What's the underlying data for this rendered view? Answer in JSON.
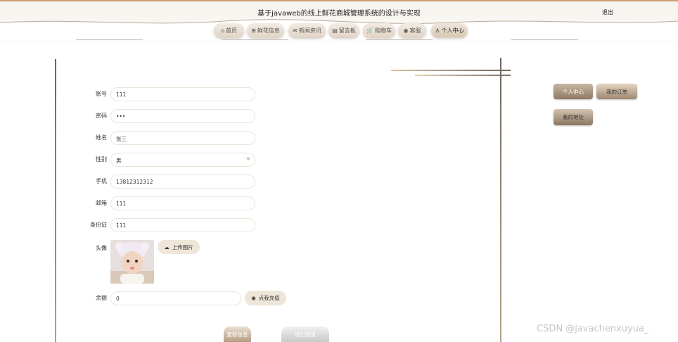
{
  "header": {
    "title": "基于javaweb的线上鲜花商城管理系统的设计与实现",
    "logout": "退出"
  },
  "nav": [
    {
      "icon": "home-icon",
      "glyph": "⌂",
      "label": "首页"
    },
    {
      "icon": "grid-icon",
      "glyph": "⊞",
      "label": "鲜花信息"
    },
    {
      "icon": "mail-icon",
      "glyph": "✉",
      "label": "新闻资讯"
    },
    {
      "icon": "board-icon",
      "glyph": "▤",
      "label": "留言板"
    },
    {
      "icon": "cart-icon",
      "glyph": "🛒",
      "label": "购物车"
    },
    {
      "icon": "service-icon",
      "glyph": "◉",
      "label": "客服"
    },
    {
      "icon": "user-icon",
      "glyph": "♙",
      "label": "个人中心"
    }
  ],
  "form": {
    "account": {
      "label": "账号",
      "value": "111"
    },
    "password": {
      "label": "密码",
      "value": "•••"
    },
    "name": {
      "label": "姓名",
      "value": "张三"
    },
    "gender": {
      "label": "性别",
      "value": "男"
    },
    "phone": {
      "label": "手机",
      "value": "13812312312"
    },
    "email": {
      "label": "邮箱",
      "value": "111"
    },
    "idcard": {
      "label": "身份证",
      "value": "111"
    },
    "avatar": {
      "label": "头像",
      "upload": "上传图片"
    },
    "balance": {
      "label": "余额",
      "value": "0",
      "recharge": "点我充值"
    }
  },
  "actions": {
    "update": "更新信息",
    "logout": "退出登录"
  },
  "sidebar": {
    "center": "个人中心",
    "orders": "我的订单",
    "address": "我的地址"
  },
  "watermark": "CSDN @javachenxuyua_"
}
